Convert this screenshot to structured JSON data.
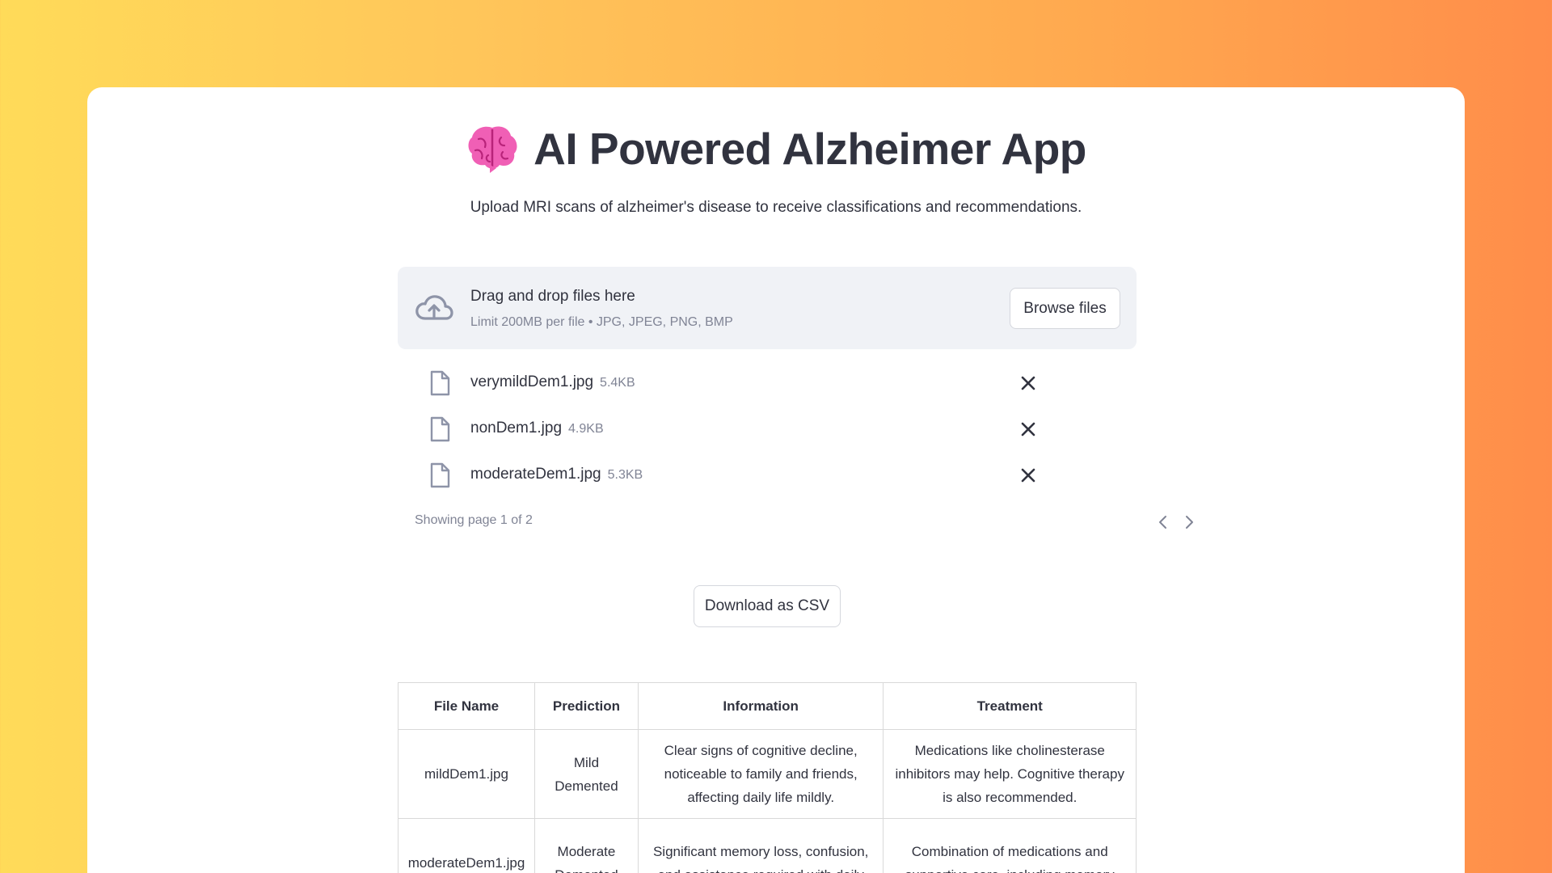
{
  "app": {
    "title": "AI Powered Alzheimer App",
    "subtitle": "Upload MRI scans of alzheimer's disease to receive classifications and recommendations.",
    "icon": "brain-icon"
  },
  "uploader": {
    "title": "Drag and drop files here",
    "limit": "Limit 200MB per file • JPG, JPEG, PNG, BMP",
    "browse_label": "Browse files",
    "files": [
      {
        "name": "verymildDem1.jpg",
        "size": "5.4KB"
      },
      {
        "name": "nonDem1.jpg",
        "size": "4.9KB"
      },
      {
        "name": "moderateDem1.jpg",
        "size": "5.3KB"
      }
    ],
    "pagination": "Showing page 1 of 2"
  },
  "download_label": "Download as CSV",
  "table": {
    "headers": [
      "File Name",
      "Prediction",
      "Information",
      "Treatment"
    ],
    "rows": [
      {
        "file": "mildDem1.jpg",
        "prediction": "Mild Demented",
        "information": "Clear signs of cognitive decline, noticeable to family and friends, affecting daily life mildly.",
        "treatment": "Medications like cholinesterase inhibitors may help. Cognitive therapy is also recommended."
      },
      {
        "file": "moderateDem1.jpg",
        "prediction": "Moderate Demented",
        "information": "Significant memory loss, confusion, and assistance required with daily",
        "treatment": "Combination of medications and supportive care, including memory"
      }
    ]
  },
  "colors": {
    "bg_gradient_start": "#ffdb59",
    "bg_gradient_end": "#ff8d4a",
    "text": "#31333f",
    "muted": "#808495",
    "dropzone_bg": "#f0f2f6",
    "brain": "#e84aa3"
  }
}
